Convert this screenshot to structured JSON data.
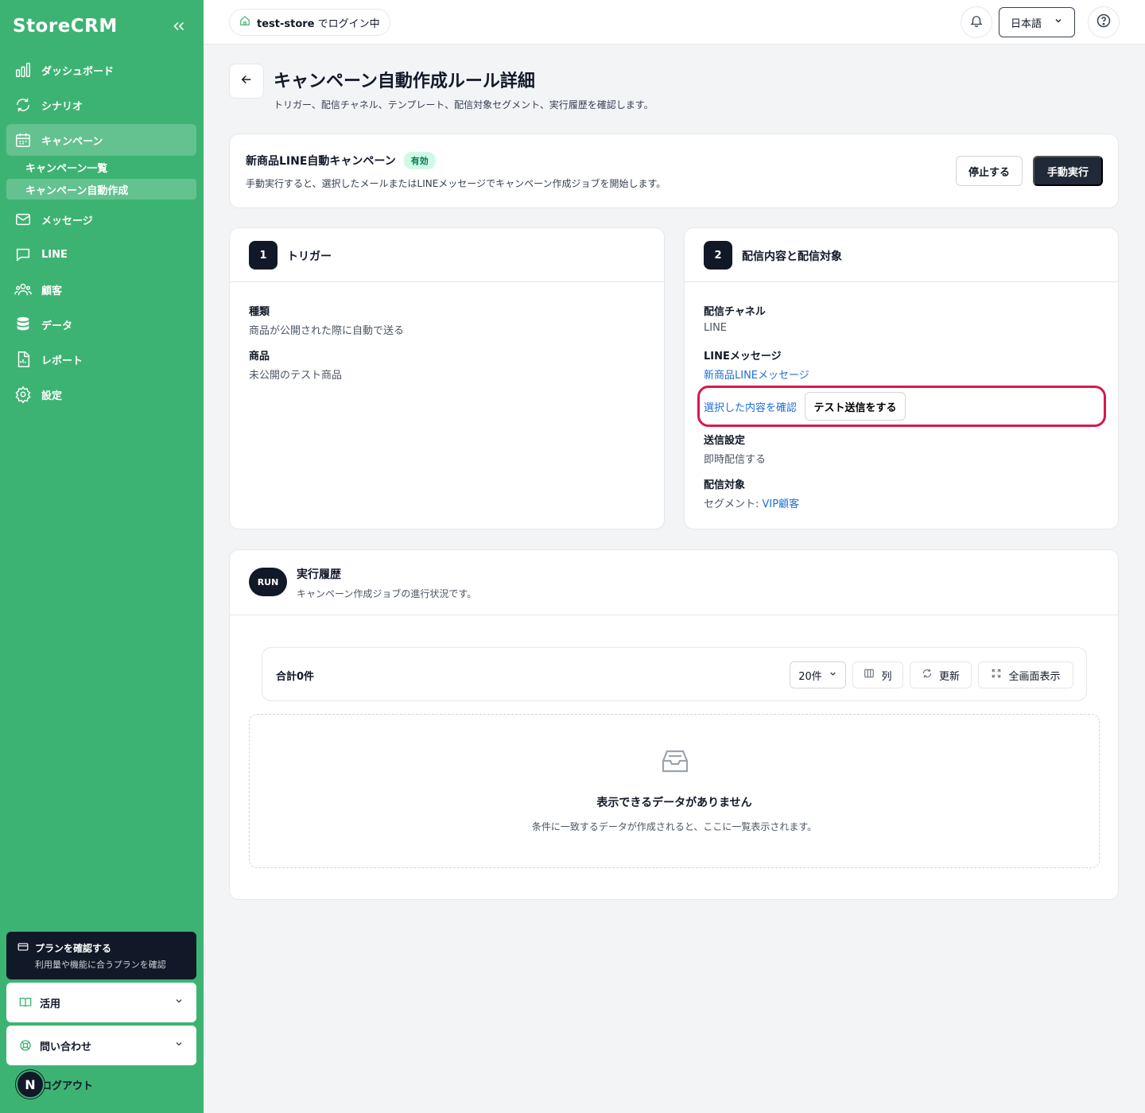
{
  "sidebar": {
    "brand": "StoreCRM",
    "nav": [
      {
        "label": "ダッシュボード",
        "icon": "bar-chart-icon"
      },
      {
        "label": "シナリオ",
        "icon": "refresh-icon"
      },
      {
        "label": "キャンペーン",
        "icon": "calendar-icon"
      },
      {
        "label": "メッセージ",
        "icon": "mail-icon"
      },
      {
        "label": "LINE",
        "icon": "chat-icon"
      },
      {
        "label": "顧客",
        "icon": "users-icon"
      },
      {
        "label": "データ",
        "icon": "database-icon"
      },
      {
        "label": "レポート",
        "icon": "file-icon"
      },
      {
        "label": "設定",
        "icon": "gear-icon"
      }
    ],
    "sub_items": [
      "キャンペーン一覧",
      "キャンペーン自動作成"
    ],
    "plan": {
      "title": "プランを確認する",
      "subtitle": "利用量や機能に合うプランを確認"
    },
    "accordions": [
      "活用",
      "問い合わせ"
    ],
    "avatar_letter": "N",
    "logout": "ログアウト"
  },
  "topbar": {
    "store_store": "test-store",
    "store_suffix": "でログイン中",
    "language": "日本語"
  },
  "page": {
    "title": "キャンペーン自動作成ルール詳細",
    "subtitle": "トリガー、配信チャネル、テンプレート、配信対象セグメント、実行履歴を確認します。"
  },
  "campaign": {
    "name": "新商品LINE自動キャンペーン",
    "status": "有効",
    "description": "手動実行すると、選択したメールまたはLINEメッセージでキャンペーン作成ジョブを開始します。",
    "stop_label": "停止する",
    "run_label": "手動実行"
  },
  "trigger": {
    "number": "1",
    "title": "トリガー",
    "type_label": "種類",
    "type_value": "商品が公開された際に自動で送る",
    "product_label": "商品",
    "product_value": "未公開のテスト商品"
  },
  "delivery": {
    "number": "2",
    "title": "配信内容と配信対象",
    "channel_label": "配信チャネル",
    "channel_value": "LINE",
    "message_label": "LINEメッセージ",
    "message_value": "新商品LINEメッセージ",
    "confirm_link": "選択した内容を確認",
    "test_send": "テスト送信をする",
    "setting_label": "送信設定",
    "setting_value": "即時配信する",
    "target_label": "配信対象",
    "target_prefix": "セグメント: ",
    "target_value": "VIP顧客"
  },
  "history": {
    "badge": "RUN",
    "title": "実行履歴",
    "subtitle": "キャンペーン作成ジョブの進行状況です。",
    "total": "合計0件",
    "page_size": "20件",
    "columns": "列",
    "refresh": "更新",
    "fullscreen": "全画面表示",
    "empty_title": "表示できるデータがありません",
    "empty_sub": "条件に一致するデータが作成されると、ここに一覧表示されます。"
  },
  "colors": {
    "sidebar": "#3db373",
    "dark": "#111827",
    "link": "#1d6fd6",
    "highlight": "#d6194d"
  }
}
